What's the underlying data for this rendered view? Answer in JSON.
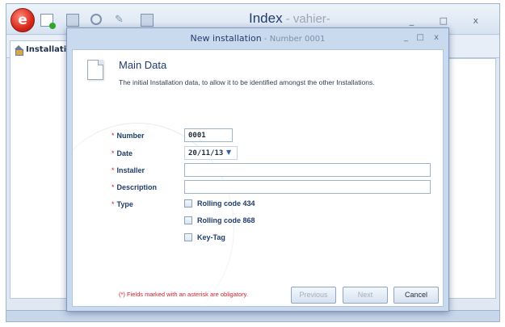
{
  "app": {
    "title": "Index",
    "title_suffix": " - vahier-",
    "window_controls": "_ □ x",
    "nav_item": "Installation"
  },
  "dialog": {
    "title": "New installation",
    "title_suffix": " - Number 0001",
    "min": "_",
    "max": "□",
    "close": "x",
    "main_title": "Main Data",
    "main_desc": "The initial Installation data, to allow it to be identified amongst the other Installations.",
    "fields": {
      "number": {
        "label": "Number",
        "value": "0001"
      },
      "date": {
        "label": "Date",
        "value": "20/11/13"
      },
      "installer": {
        "label": "Installer",
        "value": ""
      },
      "description": {
        "label": "Description",
        "value": ""
      },
      "type": {
        "label": "Type"
      }
    },
    "required_mark": "*",
    "type_options": [
      "Rolling code 434",
      "Rolling code 868",
      "Key-Tag"
    ],
    "note": "(*) Fields marked with an asterisk are obligatory.",
    "buttons": {
      "previous": "Previous",
      "next": "Next",
      "cancel": "Cancel"
    }
  },
  "colors": {
    "required": "#d22222",
    "title_blue": "#1f3d6b",
    "frame": "#c9daef"
  }
}
